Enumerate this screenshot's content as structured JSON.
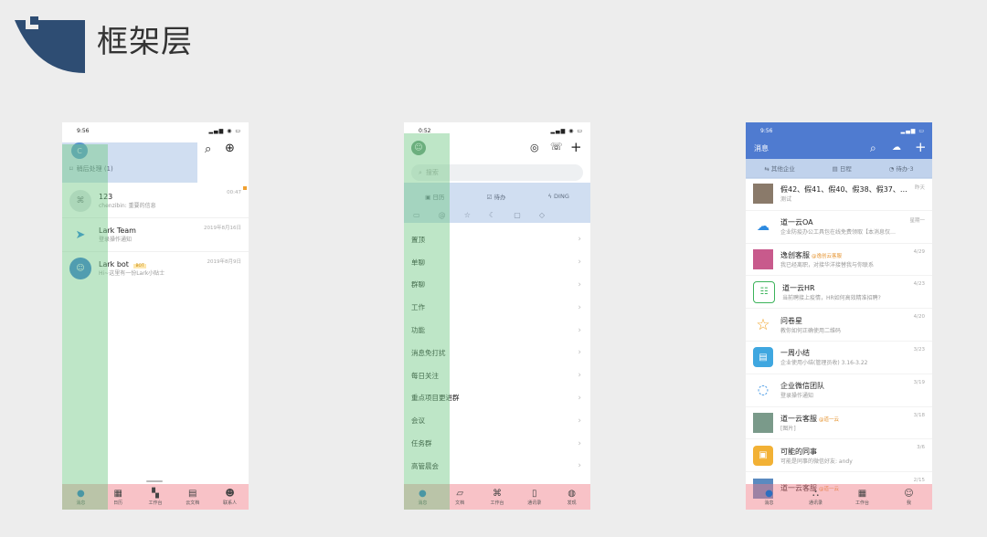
{
  "page_title": "框架层",
  "colors": {
    "brand_blue": "#2e4d73",
    "lark_header": "#4f7bd0"
  },
  "phone1": {
    "time": "9:56",
    "later_label": "稍后处理 (1)",
    "chats": [
      {
        "name": "123",
        "preview": "chenzibin: 重要的信息",
        "time": "00:47"
      },
      {
        "name": "Lark Team",
        "preview": "登录操作通知",
        "time": "2019年8月16日"
      },
      {
        "name": "Lark bot",
        "badge": "BOT",
        "preview": "Hi~这里有一份Lark小贴士",
        "time": "2019年8月9日"
      }
    ],
    "tabs": [
      {
        "label": "消息",
        "icon": "chat-icon"
      },
      {
        "label": "日历",
        "icon": "calendar-icon"
      },
      {
        "label": "工作台",
        "icon": "workspace-icon"
      },
      {
        "label": "云文档",
        "icon": "docs-icon"
      },
      {
        "label": "联系人",
        "icon": "contacts-icon"
      }
    ]
  },
  "phone2": {
    "time": "0:52",
    "search_placeholder": "搜索",
    "quick": [
      "日历",
      "待办",
      "DING"
    ],
    "groups": [
      "置顶",
      "单聊",
      "群聊",
      "工作",
      "功能",
      "消息免打扰",
      "每日关注",
      "重点项目更进群",
      "会议",
      "任务群",
      "高管晨会"
    ],
    "tabs": [
      {
        "label": "消息"
      },
      {
        "label": "文档"
      },
      {
        "label": "工作台"
      },
      {
        "label": "通讯录"
      },
      {
        "label": "发现"
      }
    ]
  },
  "phone3": {
    "time": "9:56",
    "header_title": "消息",
    "filters": [
      "其他企业",
      "日程",
      "待办·3"
    ],
    "chats": [
      {
        "name": "假42、假41、假40、假38、假37、…",
        "preview": "测试",
        "time": "昨天"
      },
      {
        "name": "道一云OA",
        "preview": "企业防疫办公工具包在线免费领取【本消息仅…",
        "time": "星期一"
      },
      {
        "name": "逸创客服",
        "tag": "@逸创云客服",
        "preview": "我已经离职，对接华洋接替我与你联系",
        "time": "4/29"
      },
      {
        "name": "道一云HR",
        "preview": "当前聘接上疫情，HR如何高效精准招聘?",
        "time": "4/23"
      },
      {
        "name": "问卷星",
        "preview": "教你如何正确使用二维码",
        "time": "4/20"
      },
      {
        "name": "一周小结",
        "preview": "企业使用小结(管理员收) 3.16-3.22",
        "time": "3/23"
      },
      {
        "name": "企业微信团队",
        "preview": "登录操作通知",
        "time": "3/19"
      },
      {
        "name": "道一云客服",
        "tag": "@道一云",
        "preview": "[图片]",
        "time": "3/18"
      },
      {
        "name": "可能的同事",
        "preview": "可能是同事的微信好友: andy",
        "time": "3/6"
      },
      {
        "name": "道一云客服",
        "tag": "@道一云",
        "preview": "",
        "time": "2/15"
      }
    ],
    "tabs": [
      {
        "label": "消息"
      },
      {
        "label": "通讯录"
      },
      {
        "label": "工作台"
      },
      {
        "label": "我"
      }
    ]
  }
}
